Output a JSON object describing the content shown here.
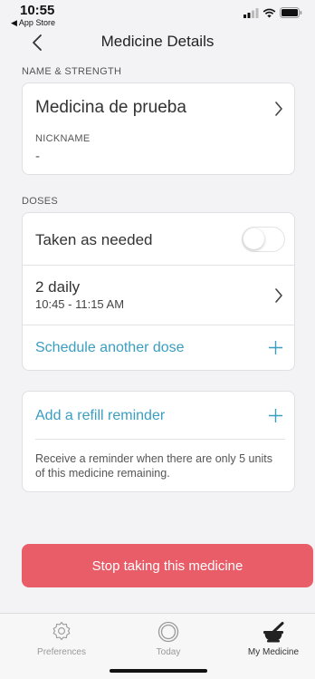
{
  "status": {
    "time": "10:55",
    "back_app": "◀ App Store"
  },
  "nav": {
    "title": "Medicine Details"
  },
  "name_section": {
    "label": "NAME & STRENGTH",
    "medicine_name": "Medicina de prueba",
    "nickname_label": "NICKNAME",
    "nickname_value": "-"
  },
  "doses_section": {
    "label": "DOSES",
    "taken_as_needed": "Taken as needed",
    "taken_as_needed_on": false,
    "dose_frequency": "2 daily",
    "dose_time": "10:45 - 11:15 AM",
    "schedule_another": "Schedule another dose"
  },
  "refill": {
    "title": "Add a refill reminder",
    "description": "Receive a reminder when there are only 5 units of this medicine remaining."
  },
  "stop_button": "Stop taking this medicine",
  "tabs": [
    {
      "label": "Preferences",
      "icon": "gear-icon",
      "active": false
    },
    {
      "label": "Today",
      "icon": "circle-icon",
      "active": false
    },
    {
      "label": "My Medicine",
      "icon": "mortar-pestle-icon",
      "active": true
    }
  ],
  "colors": {
    "accent": "#3a9ec1",
    "danger": "#e85d68",
    "background": "#f3f3f5"
  }
}
